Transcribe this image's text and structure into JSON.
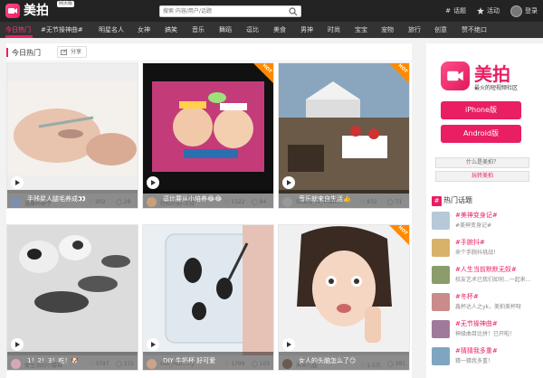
{
  "header": {
    "logo_text": "美拍",
    "web_badge": "网页版",
    "search_placeholder": "搜索 内容/用户/话题",
    "links": [
      {
        "label": "话题",
        "icon": "hash-icon"
      },
      {
        "label": "活动",
        "icon": "star-icon"
      },
      {
        "label": "登录",
        "icon": "user-icon"
      }
    ]
  },
  "nav": {
    "items": [
      "今日热门",
      "#无节操神曲#",
      "明星名人",
      "女神",
      "搞笑",
      "音乐",
      "舞蹈",
      "逗比",
      "美食",
      "男神",
      "时尚",
      "宝宝",
      "宠物",
      "旅行",
      "创意",
      "赞不绝口"
    ],
    "active_index": 0
  },
  "section": {
    "title": "今日热门",
    "share_label": "分享"
  },
  "videos": [
    {
      "caption": "手残星人腿毛养成👀",
      "user": "温馨师璟子",
      "likes": "902",
      "comments": "28",
      "hot": false
    },
    {
      "caption": "逗比要从小培养😂😂",
      "user": "轻松的刻-王叔",
      "likes": "1122",
      "comments": "84",
      "hot": true
    },
    {
      "caption": "音乐就来自生活👍",
      "user": "Shady_is_Titan...",
      "likes": "832",
      "comments": "71",
      "hot": true
    },
    {
      "caption": "1！2！3！吃！🐶",
      "user": "爱生活的小蘑菇",
      "likes": "3797",
      "comments": "372",
      "hot": false
    },
    {
      "caption": "DIY 牛奶杯 好可爱",
      "user": "Ola_mammy",
      "likes": "1799",
      "comments": "103",
      "hot": false
    },
    {
      "caption": "女人的头脑怎么了😏",
      "user": "朱禾儿妞",
      "likes": "1.5万",
      "comments": "381",
      "hot": true
    }
  ],
  "sidebar": {
    "brand_name": "美拍",
    "brand_sub": "最火的短视频社区",
    "iphone_label": "iPhone版",
    "android_label": "Android版",
    "what_label": "什么是美拍？",
    "play_label": "玩转美拍",
    "topics_title": "热门话题",
    "topics": [
      {
        "title": "#美神变身记#",
        "desc": "#美神变身记#"
      },
      {
        "title": "#手腕抖#",
        "desc": "来个手腕抖挑战！"
      },
      {
        "title": "#人生当前默默无奴#",
        "desc": "校友艺术已我们如何...一起来..."
      },
      {
        "title": "#冬杯#",
        "desc": "鑫杯达人之yk，美拍美杯呀"
      },
      {
        "title": "#无节操神曲#",
        "desc": "神级曲目比拼！已开啦！"
      },
      {
        "title": "#猜猜我多重#",
        "desc": "猜一猜我多重！"
      }
    ]
  }
}
